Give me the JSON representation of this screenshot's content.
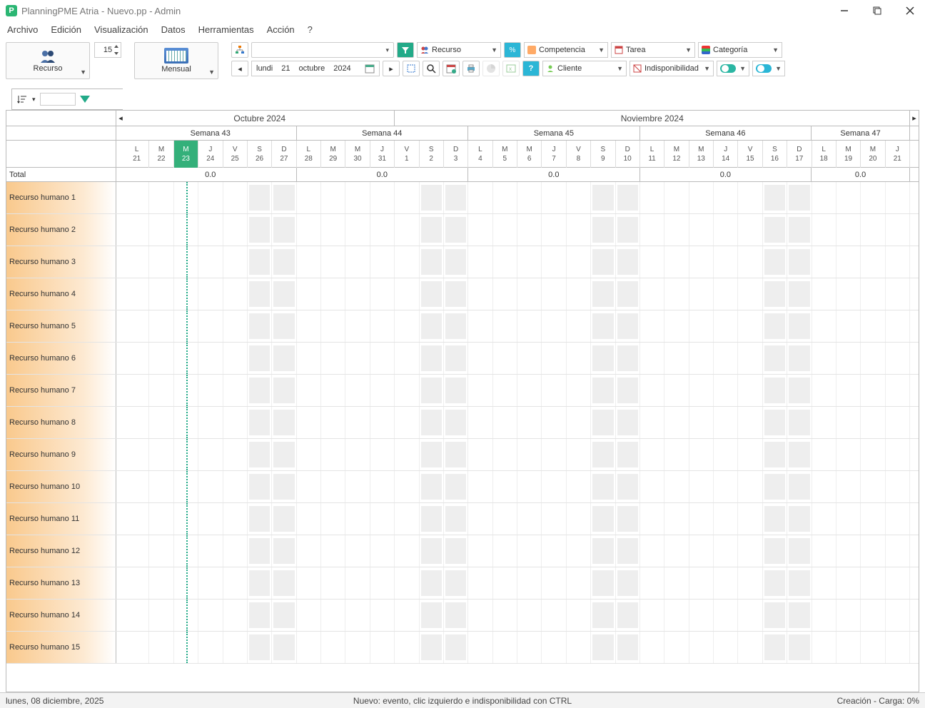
{
  "title": "PlanningPME Atria - Nuevo.pp - Admin",
  "menu": {
    "archivo": "Archivo",
    "edicion": "Edición",
    "visualizacion": "Visualización",
    "datos": "Datos",
    "herramientas": "Herramientas",
    "accion": "Acción",
    "help": "?"
  },
  "toolbar": {
    "recurso": "Recurso",
    "rows": "15",
    "mensual": "Mensual",
    "date": {
      "weekday": "lundi",
      "day": "21",
      "month": "octubre",
      "year": "2024"
    },
    "drop_recurso": "Recurso",
    "drop_cliente": "Cliente",
    "drop_comp": "Competencia",
    "drop_tarea": "Tarea",
    "drop_indisp": "Indisponibilidad",
    "drop_cat": "Categoría"
  },
  "header": {
    "months": [
      {
        "label": "Octubre 2024",
        "span": 11
      },
      {
        "label": "Noviembre 2024",
        "span": 21
      }
    ],
    "weeks": [
      {
        "label": "Semana 43",
        "span": 7
      },
      {
        "label": "Semana 44",
        "span": 7
      },
      {
        "label": "Semana 45",
        "span": 7
      },
      {
        "label": "Semana 46",
        "span": 7
      },
      {
        "label": "Semana 47",
        "span": 4
      }
    ],
    "days": [
      {
        "w": "L",
        "n": "21"
      },
      {
        "w": "M",
        "n": "22"
      },
      {
        "w": "M",
        "n": "23",
        "today": true
      },
      {
        "w": "J",
        "n": "24"
      },
      {
        "w": "V",
        "n": "25"
      },
      {
        "w": "S",
        "n": "26",
        "wk": true
      },
      {
        "w": "D",
        "n": "27",
        "wk": true
      },
      {
        "w": "L",
        "n": "28"
      },
      {
        "w": "M",
        "n": "29"
      },
      {
        "w": "M",
        "n": "30"
      },
      {
        "w": "J",
        "n": "31"
      },
      {
        "w": "V",
        "n": "1"
      },
      {
        "w": "S",
        "n": "2",
        "wk": true
      },
      {
        "w": "D",
        "n": "3",
        "wk": true
      },
      {
        "w": "L",
        "n": "4"
      },
      {
        "w": "M",
        "n": "5"
      },
      {
        "w": "M",
        "n": "6"
      },
      {
        "w": "J",
        "n": "7"
      },
      {
        "w": "V",
        "n": "8"
      },
      {
        "w": "S",
        "n": "9",
        "wk": true
      },
      {
        "w": "D",
        "n": "10",
        "wk": true
      },
      {
        "w": "L",
        "n": "11"
      },
      {
        "w": "M",
        "n": "12"
      },
      {
        "w": "M",
        "n": "13"
      },
      {
        "w": "J",
        "n": "14"
      },
      {
        "w": "V",
        "n": "15"
      },
      {
        "w": "S",
        "n": "16",
        "wk": true
      },
      {
        "w": "D",
        "n": "17",
        "wk": true
      },
      {
        "w": "L",
        "n": "18"
      },
      {
        "w": "M",
        "n": "19"
      },
      {
        "w": "M",
        "n": "20"
      },
      {
        "w": "J",
        "n": "21"
      }
    ],
    "totals": [
      {
        "v": "0.0",
        "span": 7
      },
      {
        "v": "0.0",
        "span": 7
      },
      {
        "v": "0.0",
        "span": 7
      },
      {
        "v": "0.0",
        "span": 7
      },
      {
        "v": "0.0",
        "span": 4
      }
    ],
    "total_label": "Total"
  },
  "resources": [
    "Recurso humano 1",
    "Recurso humano 2",
    "Recurso humano 3",
    "Recurso humano 4",
    "Recurso humano 5",
    "Recurso humano 6",
    "Recurso humano 7",
    "Recurso humano 8",
    "Recurso humano 9",
    "Recurso humano 10",
    "Recurso humano 11",
    "Recurso humano 12",
    "Recurso humano 13",
    "Recurso humano 14",
    "Recurso humano 15"
  ],
  "status": {
    "left": "lunes, 08 diciembre, 2025",
    "mid": "Nuevo: evento, clic izquierdo e indisponibilidad con CTRL",
    "right": "Creación - Carga: 0%"
  }
}
